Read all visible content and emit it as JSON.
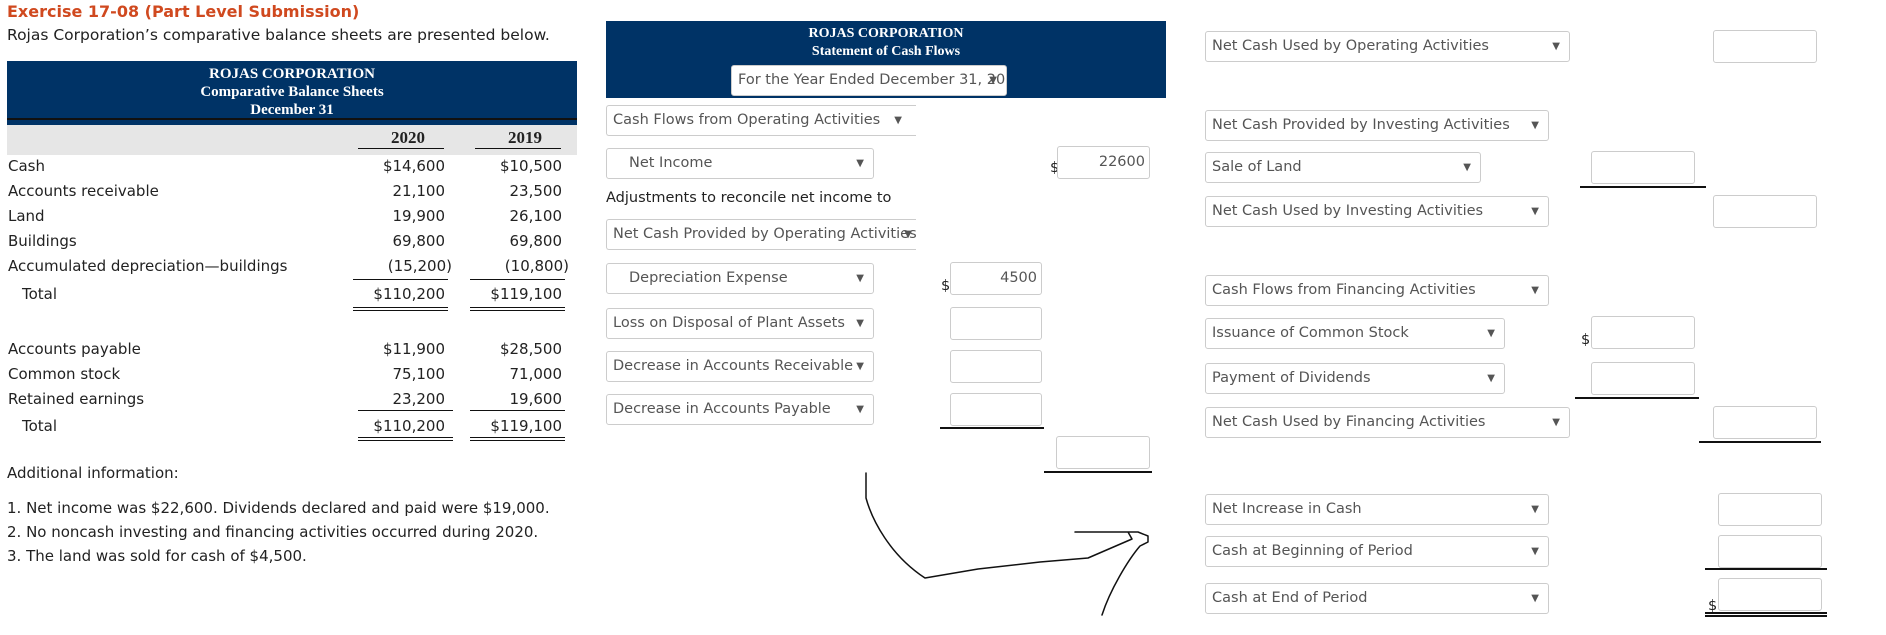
{
  "exercise": {
    "title": "Exercise 17-08 (Part Level Submission)",
    "intro": "Rojas Corporation’s comparative balance sheets are presented below."
  },
  "balance_sheet": {
    "company": "ROJAS CORPORATION",
    "title": "Comparative Balance Sheets",
    "date": "December 31",
    "years": [
      "2020",
      "2019"
    ],
    "assets": [
      {
        "label": "Cash",
        "v2020": "$14,600",
        "v2019": "$10,500"
      },
      {
        "label": "Accounts receivable",
        "v2020": "21,100",
        "v2019": "23,500"
      },
      {
        "label": "Land",
        "v2020": "19,900",
        "v2019": "26,100"
      },
      {
        "label": "Buildings",
        "v2020": "69,800",
        "v2019": "69,800"
      },
      {
        "label": "Accumulated depreciation—buildings",
        "v2020": "(15,200)",
        "v2019": "(10,800)"
      }
    ],
    "assets_total": {
      "label": "Total",
      "v2020": "$110,200",
      "v2019": "$119,100"
    },
    "liabilities": [
      {
        "label": "Accounts payable",
        "v2020": "$11,900",
        "v2019": "$28,500"
      },
      {
        "label": "Common stock",
        "v2020": "75,100",
        "v2019": "71,000"
      },
      {
        "label": "Retained earnings",
        "v2020": "23,200",
        "v2019": "19,600"
      }
    ],
    "liabilities_total": {
      "label": "Total",
      "v2020": "$110,200",
      "v2019": "$119,100"
    }
  },
  "additional_info": {
    "heading": "Additional information:",
    "items": [
      "1.  Net income was $22,600. Dividends declared and paid were $19,000.",
      "2.  No noncash investing and financing activities occurred during 2020.",
      "3.  The land was sold for cash of $4,500."
    ]
  },
  "cash_flow": {
    "company": "ROJAS CORPORATION",
    "title": "Statement of Cash Flows",
    "period_select": "For the Year Ended December 31, 2020",
    "currency": "$",
    "operating": {
      "section_select": "Cash Flows from Operating Activities",
      "net_income_select": "Net Income",
      "net_income_value": "22600",
      "adjustments_text": "Adjustments to reconcile net income to",
      "net_cash_select": "Net Cash Provided by Operating Activities",
      "adjustments": [
        {
          "select": "Depreciation Expense",
          "value": "4500"
        },
        {
          "select": "Loss on Disposal of Plant Assets",
          "value": ""
        },
        {
          "select": "Decrease in Accounts Receivable",
          "value": ""
        },
        {
          "select": "Decrease in Accounts Payable",
          "value": ""
        }
      ],
      "subtotal_value": "",
      "total_select": "Net Cash Used by Operating Activities",
      "total_value": ""
    },
    "investing": {
      "section_select": "Net Cash Provided by Investing Activities",
      "items": [
        {
          "select": "Sale of Land",
          "value": ""
        }
      ],
      "total_select": "Net Cash Used by Investing Activities",
      "total_value": ""
    },
    "financing": {
      "section_select": "Cash Flows from Financing Activities",
      "items": [
        {
          "select": "Issuance of Common Stock",
          "value": ""
        },
        {
          "select": "Payment of Dividends",
          "value": ""
        }
      ],
      "total_select": "Net Cash Used by Financing Activities",
      "total_value": ""
    },
    "summary": [
      {
        "select": "Net Increase in Cash",
        "value": ""
      },
      {
        "select": "Cash at Beginning of Period",
        "value": ""
      },
      {
        "select": "Cash at End of Period",
        "value": ""
      }
    ]
  },
  "icons": {
    "caret": "▼"
  }
}
